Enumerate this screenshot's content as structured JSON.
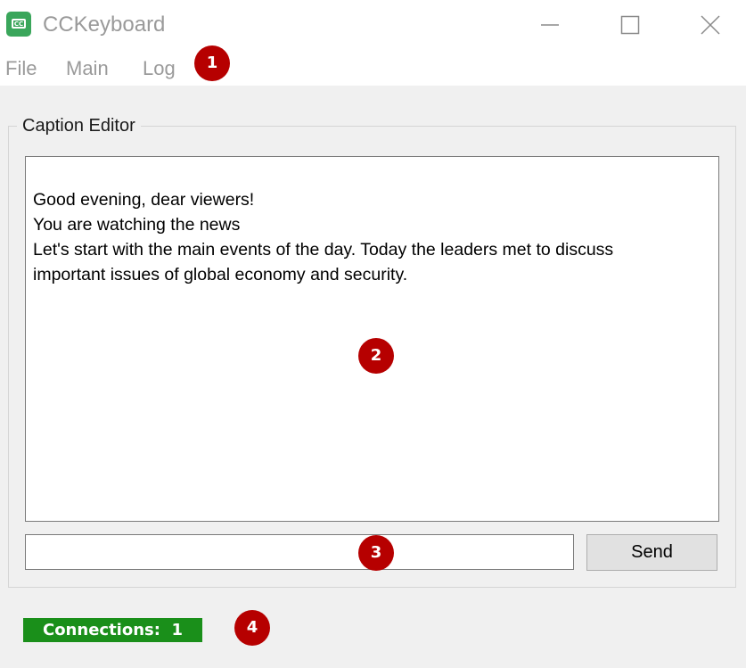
{
  "window": {
    "title": "CCKeyboard",
    "icon": "cc-keyboard-icon",
    "icon_text": "CC",
    "controls": [
      "minimize-icon",
      "maximize-icon",
      "close-icon"
    ]
  },
  "menu": {
    "items": [
      {
        "label": "File"
      },
      {
        "label": "Main"
      },
      {
        "label": "Log"
      }
    ]
  },
  "caption_editor": {
    "group_label": "Caption Editor",
    "lines": [
      "Good evening, dear viewers!",
      "You are watching the news",
      "Let's start with the main events of the day. Today the leaders met to discuss",
      "important issues of global economy and security."
    ]
  },
  "input": {
    "value": "",
    "placeholder": ""
  },
  "send_button": {
    "label": "Send"
  },
  "status": {
    "connections_label": "Connections:",
    "connections_count": "1",
    "color": "#1a8f1a"
  },
  "annotations": [
    {
      "number": "1"
    },
    {
      "number": "2"
    },
    {
      "number": "3"
    },
    {
      "number": "4"
    }
  ],
  "colors": {
    "badge": "#b60000",
    "app_icon": "#3aa65b"
  }
}
